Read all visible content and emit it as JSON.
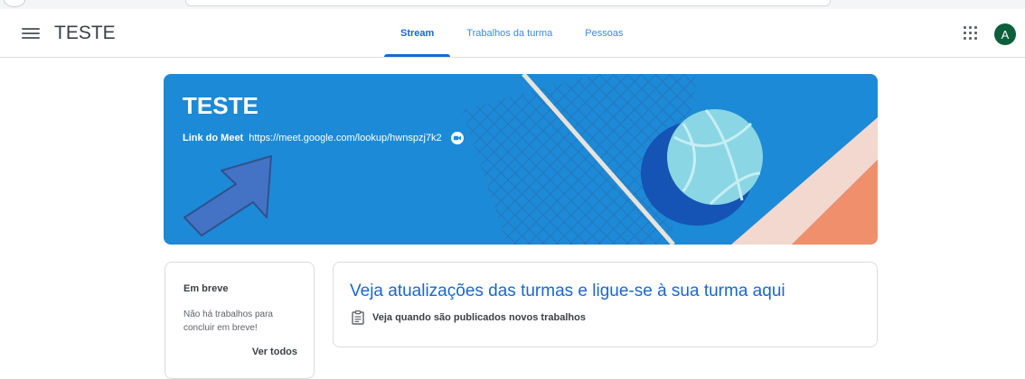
{
  "header": {
    "class_title": "TESTE",
    "tabs": [
      {
        "label": "Stream",
        "active": true
      },
      {
        "label": "Trabalhos da turma",
        "active": false
      },
      {
        "label": "Pessoas",
        "active": false
      }
    ],
    "avatar_letter": "A",
    "icons": [
      "menu-icon",
      "apps-grid-icon"
    ]
  },
  "banner": {
    "title": "TESTE",
    "meet_label": "Link do Meet",
    "meet_link": "https://meet.google.com/lookup/hwnspzj7k2",
    "meet_icon": "video-camera-icon",
    "background_color": "#1c8ad6",
    "annotation": "blue-arrow-pointing-to-meet-link"
  },
  "upcoming": {
    "title": "Em breve",
    "text": "Não há trabalhos para concluir em breve!",
    "link": "Ver todos"
  },
  "stream": {
    "heading": "Veja atualizações das turmas e ligue-se à sua turma aqui",
    "sub": "Veja quando são publicados novos trabalhos",
    "sub_icon": "assignment-icon"
  },
  "colors": {
    "accent": "#1967d2",
    "avatar": "#0b5f3a"
  }
}
